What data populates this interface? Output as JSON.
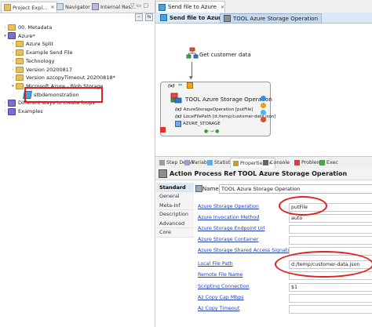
{
  "left_tabs": {
    "project_explorer": "Project Expl...",
    "navigator": "Navigator",
    "internal_res": "Internal Res..."
  },
  "tree": [
    {
      "label": "00. Metadata",
      "indent": 0,
      "expanded": false,
      "icon": "folder-icon"
    },
    {
      "label": "Azure*",
      "indent": 0,
      "expanded": true,
      "icon": "project-icon"
    },
    {
      "label": "Azure Split",
      "indent": 1,
      "expanded": false,
      "icon": "folder-icon"
    },
    {
      "label": "Example Send File",
      "indent": 1,
      "expanded": false,
      "icon": "folder-icon"
    },
    {
      "label": "Technology",
      "indent": 1,
      "expanded": false,
      "icon": "folder-icon"
    },
    {
      "label": "Version 20200817",
      "indent": 1,
      "expanded": false,
      "icon": "folder-icon"
    },
    {
      "label": "Version azcopyTimeout 20200818*",
      "indent": 1,
      "expanded": false,
      "icon": "folder-icon"
    },
    {
      "label": "Microsoft Azure - Blob Storage",
      "indent": 1,
      "expanded": true,
      "icon": "folder-icon"
    },
    {
      "label": "stbdemonstration",
      "indent": 2,
      "expanded": null,
      "icon": "process-icon"
    },
    {
      "label": "Different ways to create loops",
      "indent": 0,
      "expanded": false,
      "icon": "project-icon"
    },
    {
      "label": "Examples",
      "indent": 0,
      "expanded": false,
      "icon": "project-icon"
    }
  ],
  "editor": {
    "tab_title": "Send file to Azure",
    "breadcrumb_1": "Send file to Azure",
    "breadcrumb_2": "TOOL Azure Storage Operation"
  },
  "canvas": {
    "start_label": "Get customer data",
    "card": {
      "fx": "(x)",
      "title": "TOOL Azure Storage Operation",
      "params": [
        "AzureStorageOperation [putFile]",
        "LocalFilePath [d:/temp/customer-data.json]",
        "AZURE_STORAGE"
      ]
    }
  },
  "bottom_tabs": [
    "Step Detail",
    "Variable",
    "Statistic",
    "Properties",
    "Console",
    "Problems",
    "Exec"
  ],
  "properties": {
    "header": "Action Process Ref TOOL Azure Storage Operation",
    "side_nav": [
      "Standard",
      "General",
      "Meta-Inf",
      "Description",
      "Advanced",
      "Core"
    ],
    "name_label": "Name",
    "name_value": "TOOL Azure Storage Operation",
    "rows": [
      {
        "label": "Azure Storage Operation",
        "value": "putFile"
      },
      {
        "label": "Azure Invocation Method",
        "value": "auto"
      },
      {
        "label": "Azure Storage Endpoint Url",
        "value": ""
      },
      {
        "label": "Azure Storage Container",
        "value": ""
      },
      {
        "label": "Azure Storage Shared Access Signature",
        "value": ""
      },
      {
        "label": "Local File Path",
        "value": "d:/temp/customer-data.json"
      },
      {
        "label": "Remote File Name",
        "value": ""
      },
      {
        "label": "Scripting Connection",
        "value": "$1"
      },
      {
        "label": "Az Copy Cap Mbps",
        "value": ""
      },
      {
        "label": "Az Copy Timeout",
        "value": ""
      }
    ]
  },
  "colors": {
    "highlight_red": "#e02020",
    "link_blue": "#1f3fb0",
    "breadcrumb_bg": "#dbe8f7"
  }
}
